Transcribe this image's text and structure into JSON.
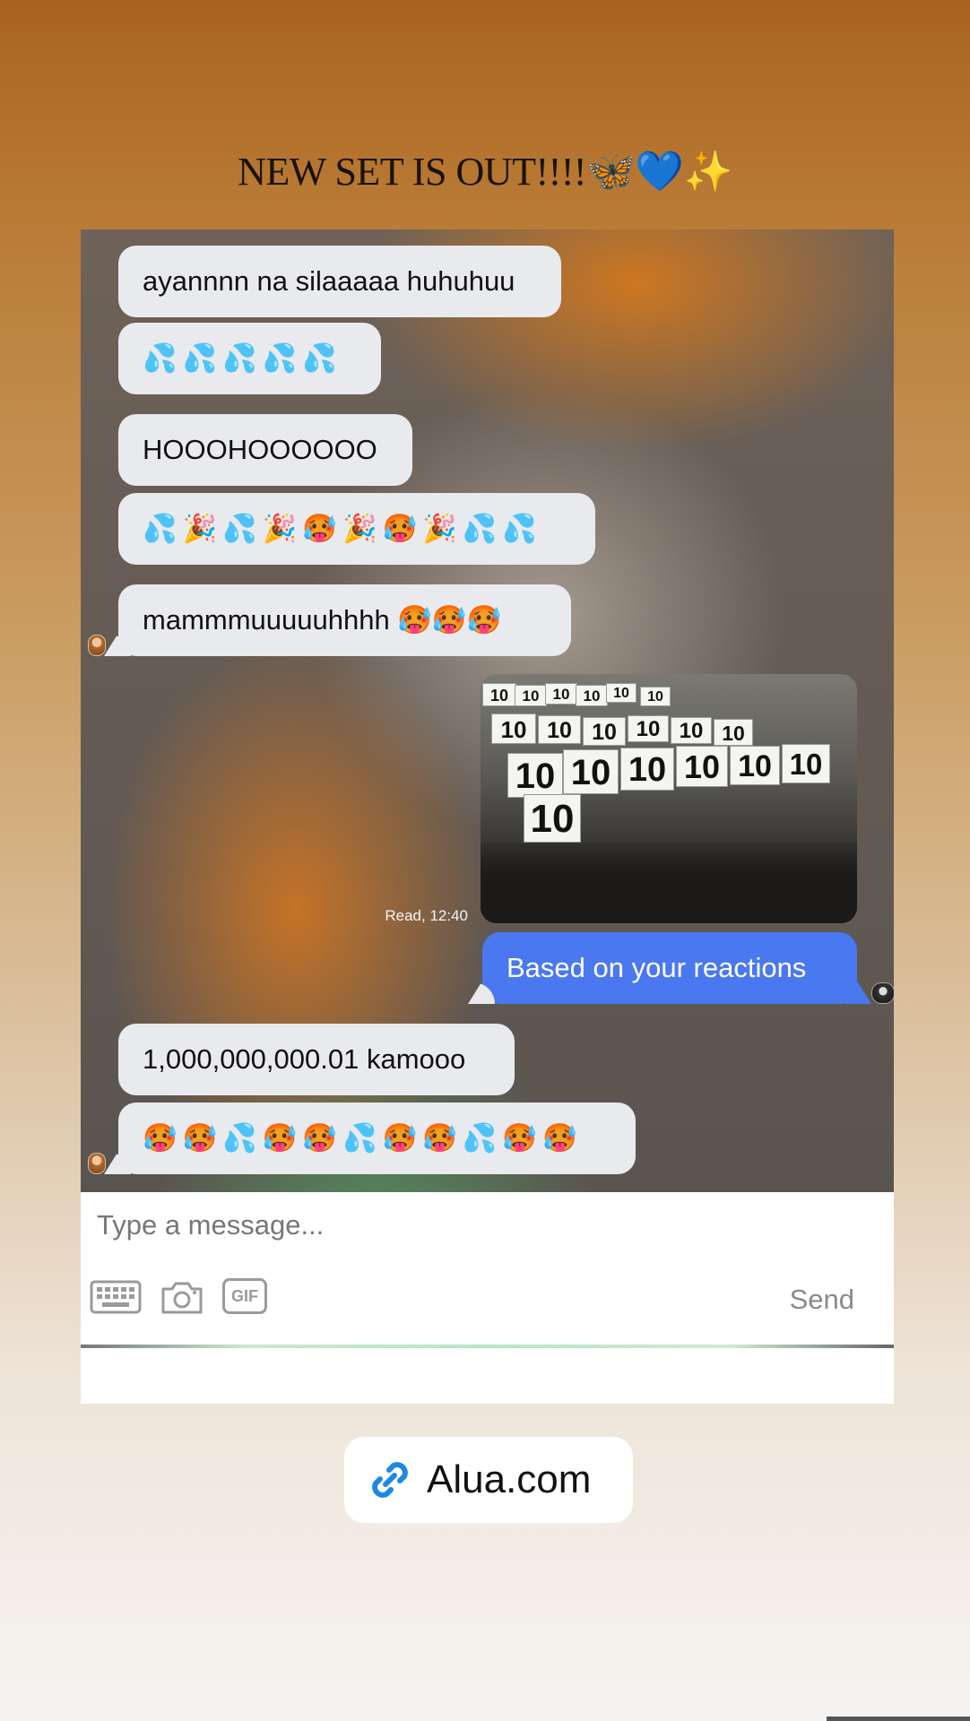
{
  "story": {
    "caption": "NEW SET IS OUT!!!!🦋💙✨"
  },
  "chat": {
    "messages": [
      {
        "from": "them",
        "text": "ayannnn na silaaaaa huhuhuu"
      },
      {
        "from": "them",
        "text": "💦💦💦💦💦"
      },
      {
        "from": "them",
        "text": "HOOOHOOOOOO"
      },
      {
        "from": "them",
        "text": "💦🎉💦🎉🥵🎉🥵🎉💦💦"
      },
      {
        "from": "them",
        "text": "mammmuuuuuhhhh 🥵🥵🥵"
      },
      {
        "from": "me",
        "type": "image",
        "signs": [
          "10",
          "10",
          "10",
          "10",
          "10",
          "10",
          "10",
          "10",
          "10",
          "10",
          "10",
          "10",
          "10",
          "10",
          "10",
          "10",
          "10",
          "10",
          "10"
        ]
      },
      {
        "from": "me",
        "text": "Based on your reactions"
      },
      {
        "from": "them",
        "text": "1,000,000,000.01 kamooo"
      },
      {
        "from": "them",
        "text": "🥵🥵💦🥵🥵💦🥵🥵💦🥵🥵"
      }
    ],
    "read_receipt": "Read, 12:40"
  },
  "composer": {
    "placeholder": "Type a message...",
    "send_label": "Send",
    "gif_label": "GIF"
  },
  "link_sticker": {
    "label": "Alua.com",
    "icon": "link-icon",
    "accent": "#1e88e5"
  }
}
